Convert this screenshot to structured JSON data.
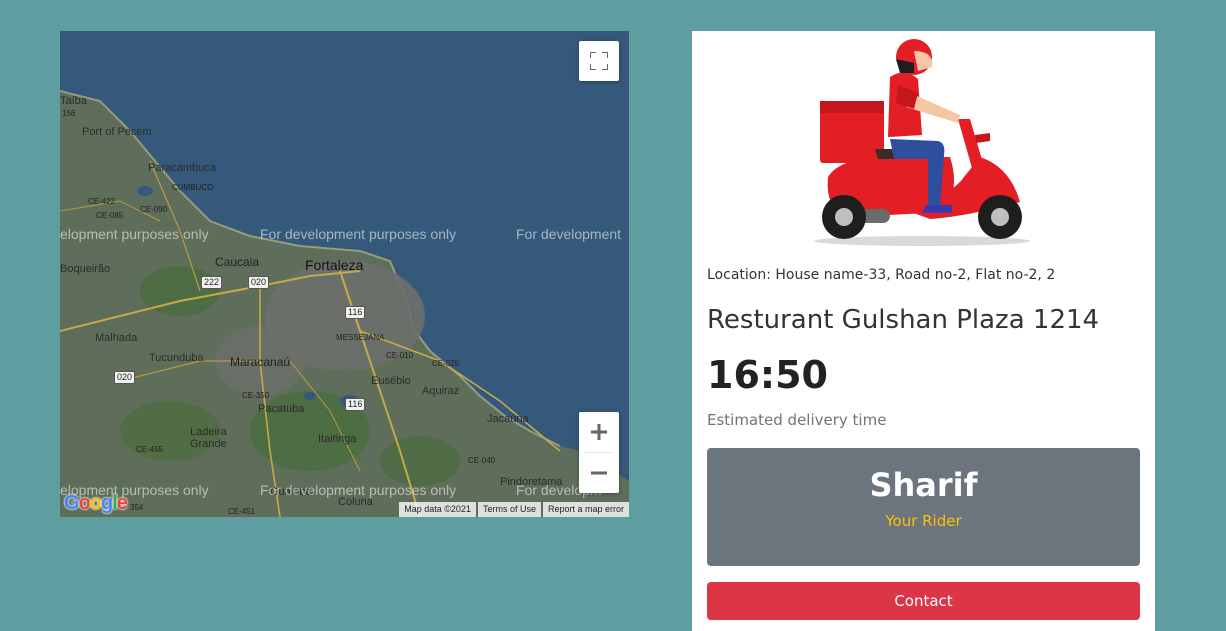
{
  "map": {
    "places": {
      "taiba": "Taíba",
      "taiba_code": "156",
      "port_of_pecem": "Port of Pecem",
      "paracambuca": "Paracambuca",
      "cumbuco": "CUMBUCO",
      "ce422": "CE-422",
      "ce090": "CE-090",
      "ce085": "CE-085",
      "boqueirao": "Boqueirão",
      "caucaia": "Caucaia",
      "fortaleza": "Fortaleza",
      "malhada": "Malhada",
      "tucunduba": "Tucunduba",
      "maracanau": "Maracanaú",
      "messejana": "MESSEJANA",
      "ce010": "CE-010",
      "ce025": "CE-025",
      "eusebio": "Eusébio",
      "aquiraz": "Aquiraz",
      "ce350": "CE-350",
      "pacatuba": "Pacatuba",
      "jacauna": "Jacaúna",
      "ladeira_grande": "Ladeira Grande",
      "itaitinga": "Itaitinga",
      "ce455": "CE-455",
      "ce040": "CE-040",
      "pindoretama": "Pindoretama",
      "guaiuba": "Guaiúba",
      "coluna": "Coluna",
      "ce451": "CE-451",
      "code_354": "354"
    },
    "shields": {
      "s222": "222",
      "s020a": "020",
      "s116a": "116",
      "s116b": "116",
      "s020b": "020"
    },
    "dev_watermark": "For development purposes only",
    "dev_watermark_left": "elopment purposes only",
    "dev_watermark_right": "For development",
    "dev_watermark_bottom_left": "elopment purposes only",
    "dev_watermark_bottom_right": "For developm",
    "attribution": {
      "map_data": "Map data ©2021",
      "terms": "Terms of Use",
      "report": "Report a map error"
    },
    "google_logo": "Google",
    "icons": {
      "fullscreen": "fullscreen-icon",
      "zoom_in": "plus-icon",
      "zoom_out": "minus-icon"
    }
  },
  "delivery": {
    "location": "Location: House name-33, Road no-2, Flat no-2, 2",
    "restaurant": "Resturant Gulshan Plaza 1214",
    "time": "16:50",
    "time_label": "Estimated delivery time",
    "rider_name": "Sharif",
    "rider_role": "Your Rider",
    "contact_label": "Contact"
  },
  "colors": {
    "page_bg": "#5f9ea0",
    "rider_box": "#6c757d",
    "rider_role": "#ffc107",
    "contact_button": "#dc3545",
    "scooter_red": "#e31e24"
  }
}
